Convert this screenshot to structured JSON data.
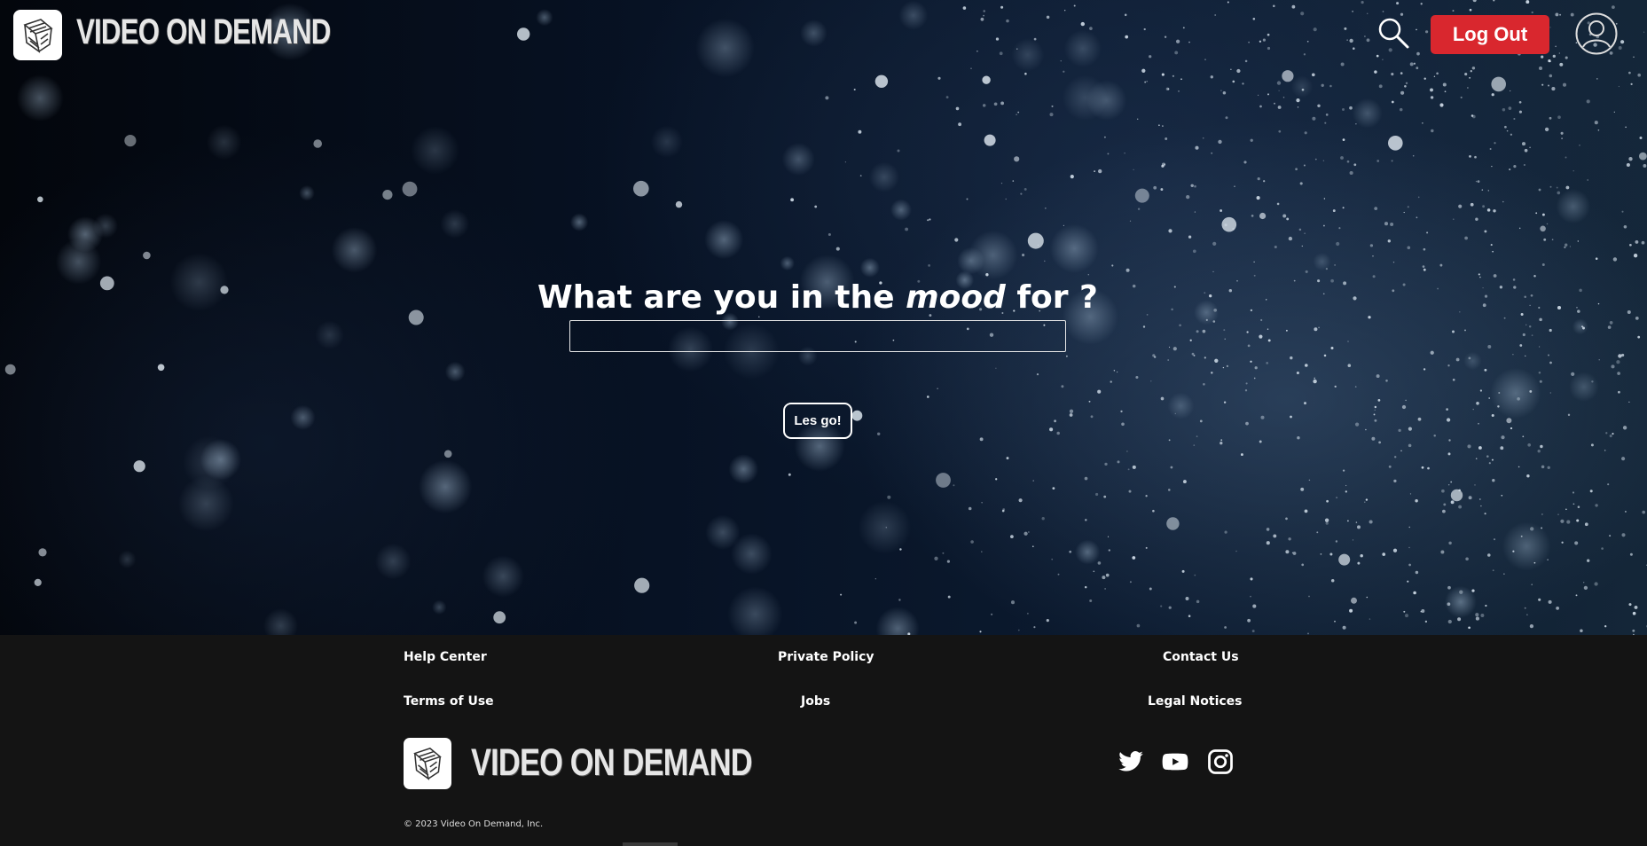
{
  "header": {
    "brand": "VIDEO ON DEMAND",
    "logout_label": "Log Out"
  },
  "hero": {
    "headline_before": "What are you in the ",
    "headline_emphasis": "mood",
    "headline_after": " for ?",
    "input_value": "",
    "submit_label": "Les go!"
  },
  "footer": {
    "links": {
      "help_center": "Help Center",
      "private_policy": "Private Policy",
      "contact_us": "Contact Us",
      "terms_of_use": "Terms of Use",
      "jobs": "Jobs",
      "legal_notices": "Legal Notices"
    },
    "brand": "VIDEO ON DEMAND",
    "social": [
      "twitter-icon",
      "youtube-icon",
      "instagram-icon"
    ],
    "copyright": "© 2023 Video On Demand, Inc."
  },
  "colors": {
    "accent_red": "#d9272e",
    "footer_bg": "#141414",
    "hero_bg": "#071224"
  }
}
